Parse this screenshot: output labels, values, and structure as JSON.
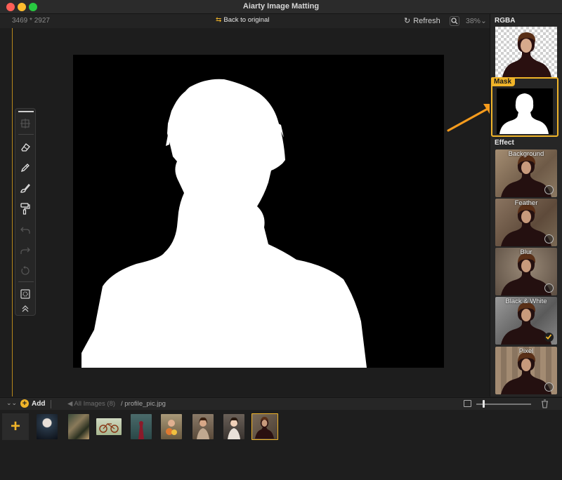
{
  "window": {
    "title": "Aiarty Image Matting"
  },
  "toolbar": {
    "dimensions": "3469 * 2927",
    "back_label": "Back to original",
    "refresh_label": "Refresh",
    "zoom_level": "38%"
  },
  "sidebar": {
    "rgba_label": "RGBA",
    "mask_label": "Mask",
    "effect_label": "Effect",
    "effects": [
      {
        "label": "Background",
        "selected": false
      },
      {
        "label": "Feather",
        "selected": false
      },
      {
        "label": "Blur",
        "selected": false
      },
      {
        "label": "Black & White",
        "selected": true
      },
      {
        "label": "Pixel",
        "selected": false
      }
    ]
  },
  "bottom": {
    "add_label": "Add",
    "all_images": "All Images (8)",
    "path": "/ profile_pic.jpg"
  },
  "filmstrip": {
    "add_symbol": "+",
    "thumbnails": [
      "jellyfish",
      "branches",
      "bicycle",
      "forest-woman",
      "flower-girl",
      "woman-portrait",
      "doll-portrait",
      "profile_pic.jpg"
    ],
    "active_index": 7
  },
  "colors": {
    "accent": "#f0b429",
    "annotation_arrow": "#f59b1d"
  }
}
